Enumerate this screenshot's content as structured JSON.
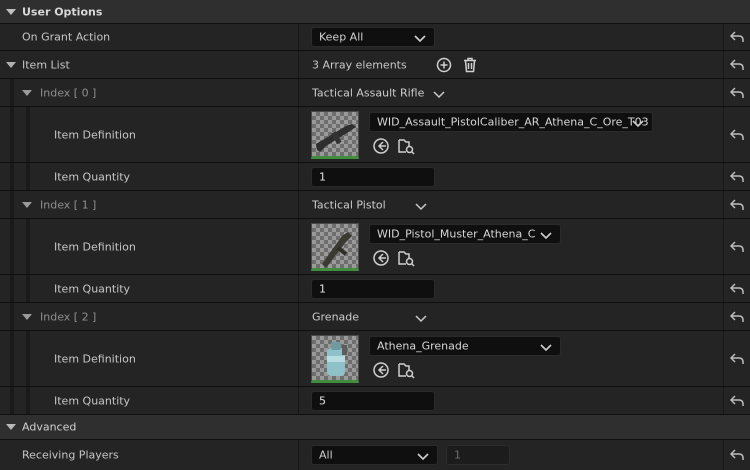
{
  "sections": {
    "user_options": "User Options",
    "advanced": "Advanced"
  },
  "on_grant_action": {
    "label": "On Grant Action",
    "value": "Keep All"
  },
  "item_list": {
    "label": "Item List",
    "summary": "3 Array elements",
    "entries": [
      {
        "index_label": "Index [ 0 ]",
        "name": "Tactical Assault Rifle",
        "definition_label": "Item Definition",
        "definition": "WID_Assault_PistolCaliber_AR_Athena_C_Ore_T03",
        "quantity_label": "Item Quantity",
        "quantity": "1"
      },
      {
        "index_label": "Index [ 1 ]",
        "name": "Tactical Pistol",
        "definition_label": "Item Definition",
        "definition": "WID_Pistol_Muster_Athena_C",
        "quantity_label": "Item Quantity",
        "quantity": "1"
      },
      {
        "index_label": "Index [ 2 ]",
        "name": "Grenade",
        "definition_label": "Item Definition",
        "definition": "Athena_Grenade",
        "quantity_label": "Item Quantity",
        "quantity": "5"
      }
    ]
  },
  "receiving_players": {
    "label": "Receiving Players",
    "value": "All",
    "count": "1"
  },
  "icons": {
    "reset": "reset-arrow-icon",
    "expand": "triangle-down-icon",
    "add": "plus-circle-icon",
    "delete": "trash-icon",
    "browse": "browse-arrow-icon",
    "find": "find-in-browser-icon"
  },
  "colors": {
    "panel": "#242424",
    "category": "#2f2f2f",
    "field": "#0f0f0f",
    "thumb_border": "#3f8f3f"
  }
}
